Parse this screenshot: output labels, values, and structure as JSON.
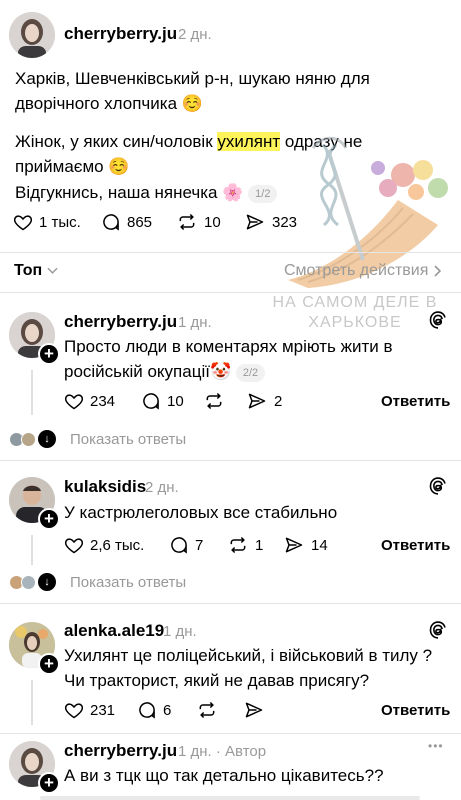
{
  "post": {
    "username": "cherryberry.ju",
    "time": "2 дн.",
    "paragraphs": {
      "p1": "Харків, Шевченківський р-н, шукаю няню для дворічного хлопчика ☺️",
      "p2_before": "Жінок, у яких син/чоловік ",
      "p2_highlight": "ухилянт",
      "p2_after": " одразу не приймаємо ☺️",
      "p3": "Відгукнись, наша нянечка 🌸",
      "p3_pill": "1/2"
    },
    "actions": {
      "likes": "1 тыс.",
      "comments": "865",
      "reposts": "10",
      "shares": "323"
    }
  },
  "sort": {
    "label": "Топ",
    "view_actions": "Смотреть действия"
  },
  "watermark": {
    "line1": "НА САМОМ ДЕЛЕ В",
    "line2": "ХАРЬКОВЕ"
  },
  "comments": [
    {
      "username": "cherryberry.ju",
      "time": "1 дн.",
      "text": "Просто люди в коментарях мріють жити в російській окупації🤡",
      "pill": "2/2",
      "likes": "234",
      "comments": "10",
      "reposts": "",
      "shares": "2",
      "reply_label": "Ответить",
      "show_replies": "Показать ответы"
    },
    {
      "username": "kulaksidis",
      "time": "2 дн.",
      "text": "У кастрюлеголовых все стабильно",
      "likes": "2,6 тыс.",
      "comments": "7",
      "reposts": "1",
      "shares": "14",
      "reply_label": "Ответить",
      "show_replies": "Показать ответы"
    },
    {
      "username": "alenka.ale19",
      "time": "1 дн.",
      "text": "Ухилянт це поліцейський, і військовий в тилу ? Чи тракторист, який не давав присягу?",
      "likes": "231",
      "comments": "6",
      "reposts": "",
      "shares": "",
      "reply_label": "Ответить"
    },
    {
      "username": "cherryberry.ju",
      "time": "1 дн. · Автор",
      "text": "А ви з тцк що так детально цікавитесь??",
      "more": "•••"
    }
  ],
  "colors": {
    "highlight": "#fdf35a",
    "muted": "#9a9a9a",
    "divider": "#e4e4e4"
  }
}
